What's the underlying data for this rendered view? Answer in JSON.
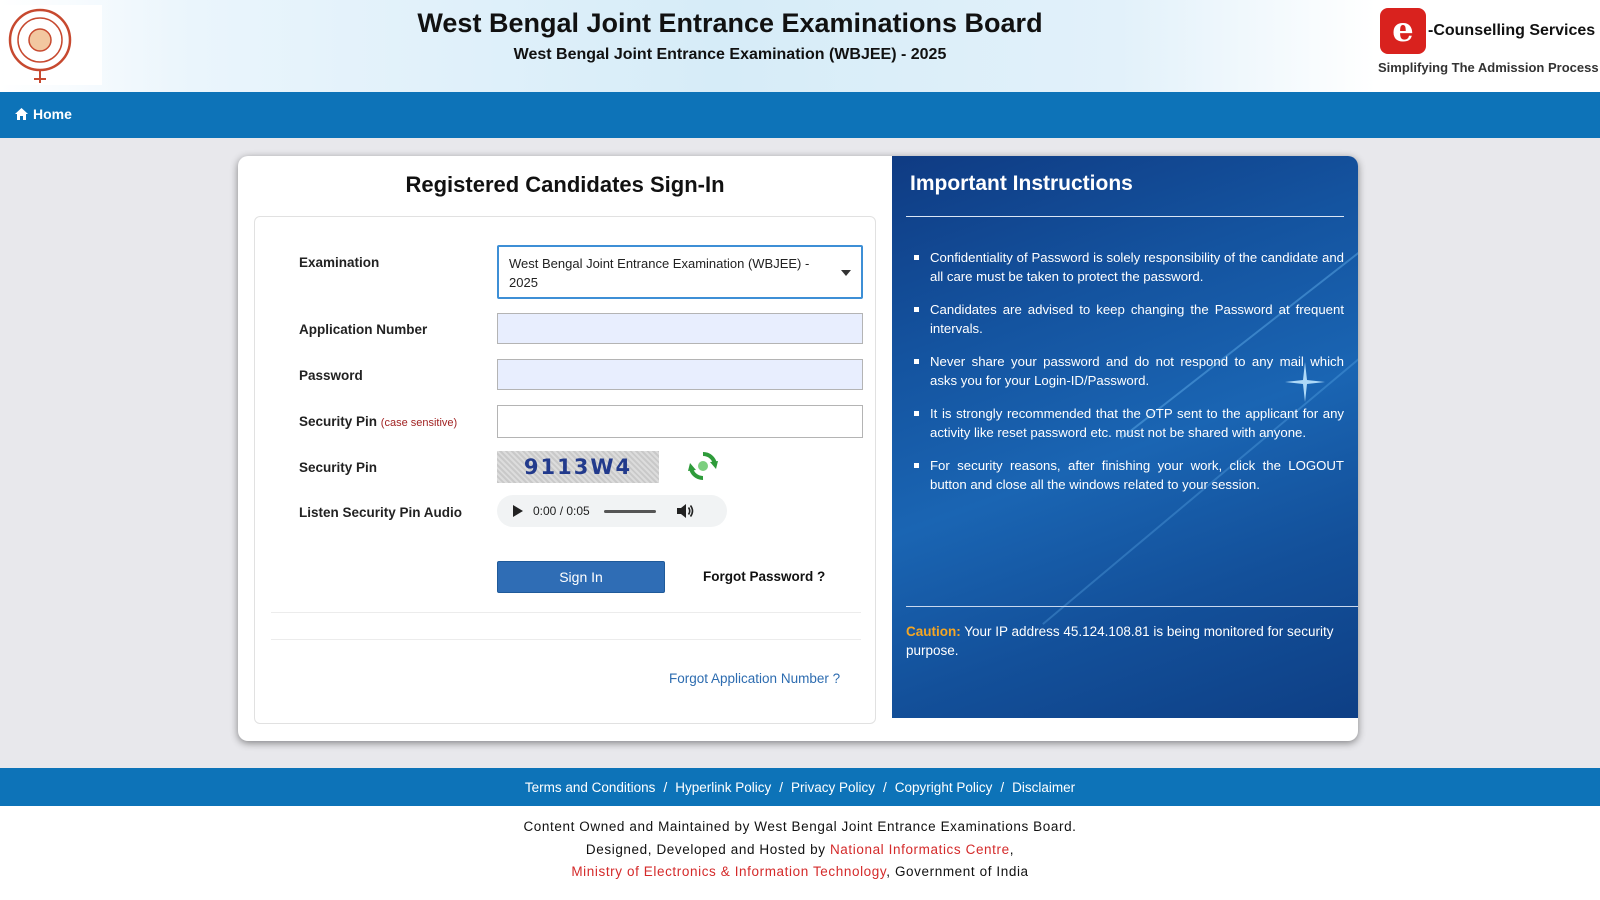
{
  "header": {
    "title": "West Bengal Joint Entrance Examinations Board",
    "subtitle": "West Bengal Joint Entrance Examination (WBJEE) - 2025",
    "ec_icon": "e",
    "ec_brand": "-Counselling Services",
    "ec_tagline": "Simplifying The Admission Process"
  },
  "nav": {
    "home": "Home"
  },
  "form": {
    "title": "Registered Candidates Sign-In",
    "examination_label": "Examination",
    "examination_value": "West Bengal Joint Entrance Examination (WBJEE) - 2025",
    "application_number_label": "Application Number",
    "application_number_value": "",
    "password_label": "Password",
    "password_value": "",
    "security_pin_input_label": "Security Pin",
    "case_sensitive": "(case sensitive)",
    "security_pin_input_value": "",
    "security_pin_label": "Security Pin",
    "captcha": "9113W4",
    "audio_label": "Listen Security Pin Audio",
    "audio_time": "0:00 / 0:05",
    "signin": "Sign In",
    "forgot_password": "Forgot Password ?",
    "forgot_application": "Forgot Application Number ?"
  },
  "instructions": {
    "title": "Important Instructions",
    "items": [
      "Confidentiality of Password is solely responsibility of the candidate and all care must be taken to protect the password.",
      "Candidates are advised to keep changing the Password at frequent intervals.",
      "Never share your password and do not respond to any mail which asks you for your Login-ID/Password.",
      "It is strongly recommended that the OTP sent to the applicant for any activity like reset password etc. must not be shared with anyone.",
      "For security reasons, after finishing your work, click the LOGOUT button and close all the windows related to your session."
    ],
    "caution_label": "Caution:",
    "caution_text": " Your IP address 45.124.108.81 is being monitored for security purpose."
  },
  "footer": {
    "links": [
      "Terms and Conditions",
      "Hyperlink Policy",
      "Privacy Policy",
      "Copyright Policy",
      "Disclaimer"
    ],
    "separator": "/",
    "line1": "Content Owned and Maintained by West Bengal Joint Entrance Examinations Board.",
    "line2_prefix": "Designed, Developed and Hosted by ",
    "line2_link": "National Informatics Centre",
    "line2_suffix": ",",
    "line3_link": "Ministry of Electronics & Information Technology",
    "line3_suffix": ", Government of India"
  },
  "colors": {
    "nav_blue": "#0d73b8",
    "panel_blue": "#14539f",
    "button_blue": "#2f6db5",
    "caution_orange": "#f5a623",
    "link_red": "#d42a2a"
  }
}
